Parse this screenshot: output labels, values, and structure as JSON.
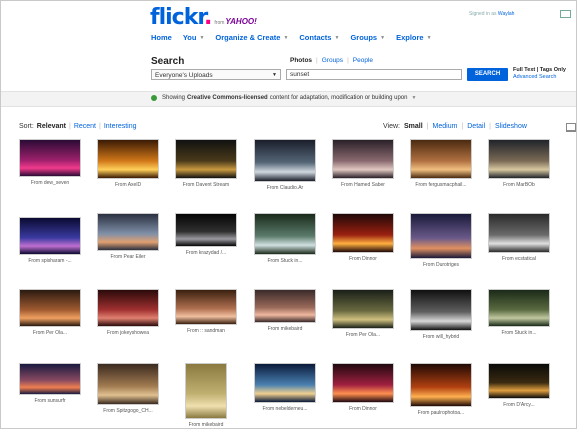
{
  "header": {
    "logo": "flickr",
    "logo_from": "from",
    "logo_yahoo": "YAHOO!",
    "signed_in_prefix": "Signed in as",
    "username": "Waylah",
    "nav": [
      {
        "label": "Home",
        "caret": false
      },
      {
        "label": "You",
        "caret": true
      },
      {
        "label": "Organize & Create",
        "caret": true
      },
      {
        "label": "Contacts",
        "caret": true
      },
      {
        "label": "Groups",
        "caret": true
      },
      {
        "label": "Explore",
        "caret": true
      }
    ]
  },
  "search": {
    "label": "Search",
    "tabs": [
      "Photos",
      "Groups",
      "People"
    ],
    "scope_value": "Everyone's Uploads",
    "query": "sunset",
    "button": "SEARCH",
    "full_text": "Full Text | Tags Only",
    "advanced": "Advanced Search"
  },
  "cc": {
    "prefix": "Showing",
    "bold": "Creative Commons-licensed",
    "suffix": "content for adaptation, modification or building upon"
  },
  "sort": {
    "label": "Sort:",
    "active": "Relevant",
    "options": [
      "Recent",
      "Interesting"
    ]
  },
  "view": {
    "label": "View:",
    "active": "Small",
    "options": [
      "Medium",
      "Detail",
      "Slideshow"
    ]
  },
  "photos": [
    {
      "caption": "From dew_seven",
      "colors": [
        "#2a0b35",
        "#9a1f6a",
        "#f23a8c"
      ]
    },
    {
      "caption": "From AxelD",
      "colors": [
        "#3a1a05",
        "#d07718",
        "#ffd05a"
      ]
    },
    {
      "caption": "From Davent Stream",
      "colors": [
        "#111111",
        "#4a3a1a",
        "#c89a40"
      ]
    },
    {
      "caption": "From Claudio.Ar",
      "colors": [
        "#1a1e2a",
        "#556677",
        "#d0d8e0"
      ]
    },
    {
      "caption": "From Hamed Saber",
      "colors": [
        "#2a2028",
        "#8a6a70",
        "#e0c8c0"
      ]
    },
    {
      "caption": "From fergusmacphail...",
      "colors": [
        "#4a2a10",
        "#b07040",
        "#f0c080"
      ]
    },
    {
      "caption": "From MarBOb",
      "colors": [
        "#20242a",
        "#7a6a55",
        "#d8c8a0"
      ]
    },
    {
      "caption": "From spisharam -...",
      "colors": [
        "#0a0a30",
        "#3a3aa0",
        "#c070d0"
      ]
    },
    {
      "caption": "From Pear Eiler",
      "colors": [
        "#2a3040",
        "#8090a8",
        "#e0a070"
      ]
    },
    {
      "caption": "From krazydad /...",
      "colors": [
        "#050505",
        "#303030",
        "#9a9aa0"
      ]
    },
    {
      "caption": "From Stuck in...",
      "colors": [
        "#1a2a1a",
        "#5a7a6a",
        "#d0e0e0"
      ]
    },
    {
      "caption": "From Dinnor",
      "colors": [
        "#200808",
        "#9a2010",
        "#ffb040"
      ]
    },
    {
      "caption": "From Durotriges",
      "colors": [
        "#1a1a3a",
        "#6a5a8a",
        "#e09060"
      ]
    },
    {
      "caption": "From ecstatical",
      "colors": [
        "#2a2a2a",
        "#6a6a6a",
        "#e0e0e0"
      ]
    },
    {
      "caption": "From Per Ola...",
      "colors": [
        "#2a1a10",
        "#a05a30",
        "#f0a060"
      ]
    },
    {
      "caption": "From jokeyshowea",
      "colors": [
        "#2a0a0a",
        "#a03030",
        "#e08070"
      ]
    },
    {
      "caption": "From :: sandman",
      "colors": [
        "#3a2010",
        "#b07050",
        "#f0c0a0"
      ]
    },
    {
      "caption": "From mikebaird",
      "colors": [
        "#3a2a2a",
        "#9a6a5a",
        "#f0b8a0"
      ]
    },
    {
      "caption": "From Per Ola...",
      "colors": [
        "#1a2018",
        "#6a6a40",
        "#d0c080"
      ]
    },
    {
      "caption": "From will_hybrid",
      "colors": [
        "#101010",
        "#606060",
        "#d8d8d8"
      ]
    },
    {
      "caption": "From Stuck in...",
      "colors": [
        "#1a2a18",
        "#5a6a40",
        "#c0c8a0"
      ]
    },
    {
      "caption": "From sunsurfr",
      "colors": [
        "#1a1a40",
        "#8a4a60",
        "#f08050"
      ]
    },
    {
      "caption": "From Spitzgogo_CH...",
      "colors": [
        "#3a2a20",
        "#a07a50",
        "#e0c090"
      ]
    },
    {
      "caption": "From mikebaird",
      "colors": [
        "#8a7a40",
        "#c0b070",
        "#f0e0b0"
      ]
    },
    {
      "caption": "From nebelderneu...",
      "colors": [
        "#0a1a3a",
        "#4a80b0",
        "#f0d090"
      ]
    },
    {
      "caption": "From Dinnor",
      "colors": [
        "#200810",
        "#a02040",
        "#ff9050"
      ]
    },
    {
      "caption": "From paulrophotoa...",
      "colors": [
        "#200a05",
        "#b04010",
        "#ffb050"
      ]
    },
    {
      "caption": "From D'Arcy...",
      "colors": [
        "#0a0a0a",
        "#3a2a10",
        "#e0a040"
      ]
    }
  ]
}
